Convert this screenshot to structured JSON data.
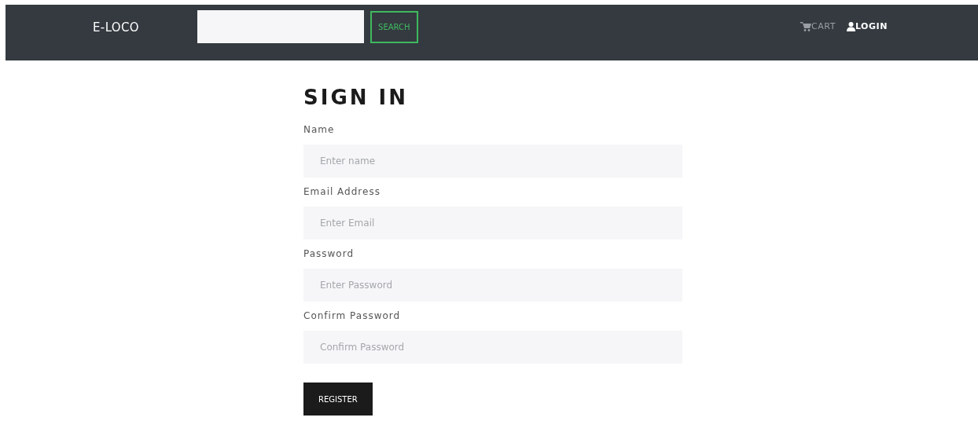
{
  "navbar": {
    "brand": "E-LOCO",
    "search": {
      "button": "SEARCH"
    },
    "links": [
      {
        "kind": "cart",
        "label": "CART",
        "active": false
      },
      {
        "kind": "user",
        "label": "LOGIN",
        "active": true
      }
    ]
  },
  "form": {
    "title": "SIGN IN",
    "fields": [
      {
        "label": "Name",
        "placeholder": "Enter name"
      },
      {
        "label": "Email Address",
        "placeholder": "Enter Email"
      },
      {
        "label": "Password",
        "placeholder": "Enter Password"
      },
      {
        "label": "Confirm Password",
        "placeholder": "Confirm Password"
      }
    ],
    "submit": "REGISTER"
  }
}
